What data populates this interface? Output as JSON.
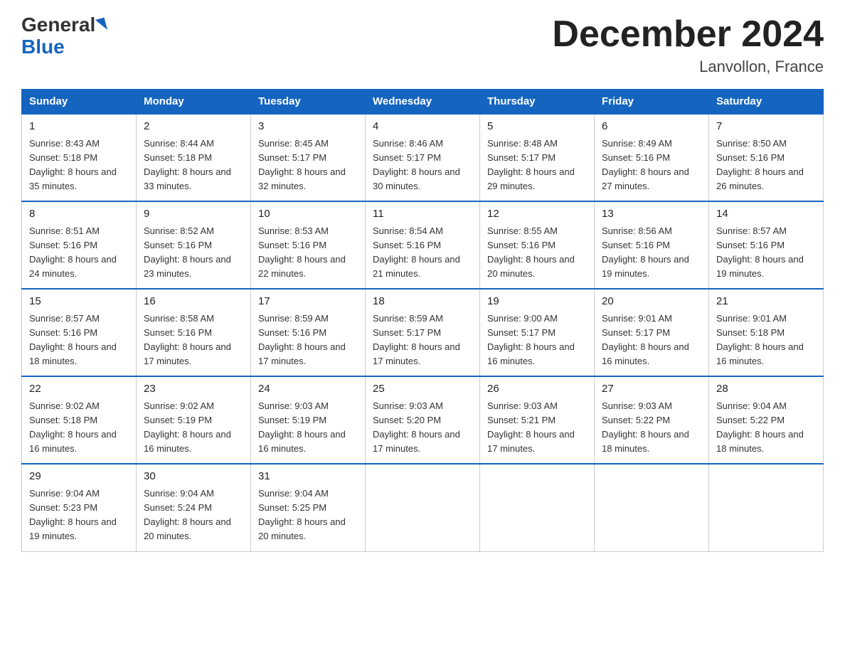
{
  "header": {
    "logo": {
      "general": "General",
      "blue": "Blue",
      "aria": "GeneralBlue logo"
    },
    "title": "December 2024",
    "location": "Lanvollon, France"
  },
  "calendar": {
    "days_of_week": [
      "Sunday",
      "Monday",
      "Tuesday",
      "Wednesday",
      "Thursday",
      "Friday",
      "Saturday"
    ],
    "weeks": [
      [
        {
          "day": "1",
          "sunrise": "8:43 AM",
          "sunset": "5:18 PM",
          "daylight": "8 hours and 35 minutes."
        },
        {
          "day": "2",
          "sunrise": "8:44 AM",
          "sunset": "5:18 PM",
          "daylight": "8 hours and 33 minutes."
        },
        {
          "day": "3",
          "sunrise": "8:45 AM",
          "sunset": "5:17 PM",
          "daylight": "8 hours and 32 minutes."
        },
        {
          "day": "4",
          "sunrise": "8:46 AM",
          "sunset": "5:17 PM",
          "daylight": "8 hours and 30 minutes."
        },
        {
          "day": "5",
          "sunrise": "8:48 AM",
          "sunset": "5:17 PM",
          "daylight": "8 hours and 29 minutes."
        },
        {
          "day": "6",
          "sunrise": "8:49 AM",
          "sunset": "5:16 PM",
          "daylight": "8 hours and 27 minutes."
        },
        {
          "day": "7",
          "sunrise": "8:50 AM",
          "sunset": "5:16 PM",
          "daylight": "8 hours and 26 minutes."
        }
      ],
      [
        {
          "day": "8",
          "sunrise": "8:51 AM",
          "sunset": "5:16 PM",
          "daylight": "8 hours and 24 minutes."
        },
        {
          "day": "9",
          "sunrise": "8:52 AM",
          "sunset": "5:16 PM",
          "daylight": "8 hours and 23 minutes."
        },
        {
          "day": "10",
          "sunrise": "8:53 AM",
          "sunset": "5:16 PM",
          "daylight": "8 hours and 22 minutes."
        },
        {
          "day": "11",
          "sunrise": "8:54 AM",
          "sunset": "5:16 PM",
          "daylight": "8 hours and 21 minutes."
        },
        {
          "day": "12",
          "sunrise": "8:55 AM",
          "sunset": "5:16 PM",
          "daylight": "8 hours and 20 minutes."
        },
        {
          "day": "13",
          "sunrise": "8:56 AM",
          "sunset": "5:16 PM",
          "daylight": "8 hours and 19 minutes."
        },
        {
          "day": "14",
          "sunrise": "8:57 AM",
          "sunset": "5:16 PM",
          "daylight": "8 hours and 19 minutes."
        }
      ],
      [
        {
          "day": "15",
          "sunrise": "8:57 AM",
          "sunset": "5:16 PM",
          "daylight": "8 hours and 18 minutes."
        },
        {
          "day": "16",
          "sunrise": "8:58 AM",
          "sunset": "5:16 PM",
          "daylight": "8 hours and 17 minutes."
        },
        {
          "day": "17",
          "sunrise": "8:59 AM",
          "sunset": "5:16 PM",
          "daylight": "8 hours and 17 minutes."
        },
        {
          "day": "18",
          "sunrise": "8:59 AM",
          "sunset": "5:17 PM",
          "daylight": "8 hours and 17 minutes."
        },
        {
          "day": "19",
          "sunrise": "9:00 AM",
          "sunset": "5:17 PM",
          "daylight": "8 hours and 16 minutes."
        },
        {
          "day": "20",
          "sunrise": "9:01 AM",
          "sunset": "5:17 PM",
          "daylight": "8 hours and 16 minutes."
        },
        {
          "day": "21",
          "sunrise": "9:01 AM",
          "sunset": "5:18 PM",
          "daylight": "8 hours and 16 minutes."
        }
      ],
      [
        {
          "day": "22",
          "sunrise": "9:02 AM",
          "sunset": "5:18 PM",
          "daylight": "8 hours and 16 minutes."
        },
        {
          "day": "23",
          "sunrise": "9:02 AM",
          "sunset": "5:19 PM",
          "daylight": "8 hours and 16 minutes."
        },
        {
          "day": "24",
          "sunrise": "9:03 AM",
          "sunset": "5:19 PM",
          "daylight": "8 hours and 16 minutes."
        },
        {
          "day": "25",
          "sunrise": "9:03 AM",
          "sunset": "5:20 PM",
          "daylight": "8 hours and 17 minutes."
        },
        {
          "day": "26",
          "sunrise": "9:03 AM",
          "sunset": "5:21 PM",
          "daylight": "8 hours and 17 minutes."
        },
        {
          "day": "27",
          "sunrise": "9:03 AM",
          "sunset": "5:22 PM",
          "daylight": "8 hours and 18 minutes."
        },
        {
          "day": "28",
          "sunrise": "9:04 AM",
          "sunset": "5:22 PM",
          "daylight": "8 hours and 18 minutes."
        }
      ],
      [
        {
          "day": "29",
          "sunrise": "9:04 AM",
          "sunset": "5:23 PM",
          "daylight": "8 hours and 19 minutes."
        },
        {
          "day": "30",
          "sunrise": "9:04 AM",
          "sunset": "5:24 PM",
          "daylight": "8 hours and 20 minutes."
        },
        {
          "day": "31",
          "sunrise": "9:04 AM",
          "sunset": "5:25 PM",
          "daylight": "8 hours and 20 minutes."
        },
        null,
        null,
        null,
        null
      ]
    ]
  }
}
